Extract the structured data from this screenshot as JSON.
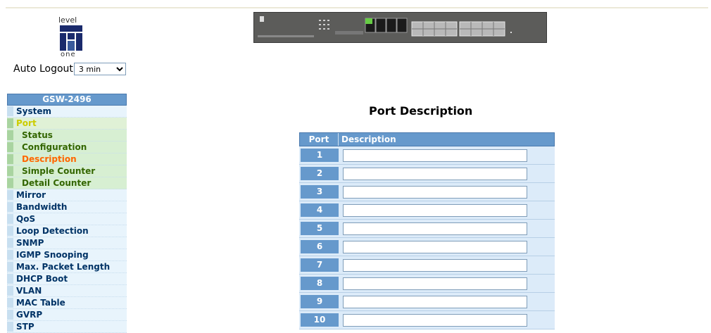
{
  "logo": {
    "top_text": "level",
    "bottom_text": "one"
  },
  "auto_logout": {
    "label": "Auto Logout",
    "selected": "3 min"
  },
  "menu": {
    "title": "GSW-2496",
    "items": [
      {
        "label": "System",
        "type": "item"
      },
      {
        "label": "Port",
        "type": "active"
      },
      {
        "label": "Status",
        "type": "sub"
      },
      {
        "label": "Configuration",
        "type": "sub"
      },
      {
        "label": "Description",
        "type": "sub-current"
      },
      {
        "label": "Simple Counter",
        "type": "sub"
      },
      {
        "label": "Detail Counter",
        "type": "sub"
      },
      {
        "label": "Mirror",
        "type": "item"
      },
      {
        "label": "Bandwidth",
        "type": "item"
      },
      {
        "label": "QoS",
        "type": "item"
      },
      {
        "label": "Loop Detection",
        "type": "item"
      },
      {
        "label": "SNMP",
        "type": "item"
      },
      {
        "label": "IGMP Snooping",
        "type": "item"
      },
      {
        "label": "Max. Packet Length",
        "type": "item"
      },
      {
        "label": "DHCP Boot",
        "type": "item"
      },
      {
        "label": "VLAN",
        "type": "item"
      },
      {
        "label": "MAC Table",
        "type": "item"
      },
      {
        "label": "GVRP",
        "type": "item"
      },
      {
        "label": "STP",
        "type": "item"
      }
    ]
  },
  "page": {
    "title": "Port Description",
    "col_port": "Port",
    "col_description": "Description",
    "ports": [
      "1",
      "2",
      "3",
      "4",
      "5",
      "6",
      "7",
      "8",
      "9",
      "10"
    ]
  },
  "colors": {
    "header_blue": "#6699cc",
    "active_yellow": "#cccc00",
    "current_orange": "#ff6600"
  }
}
